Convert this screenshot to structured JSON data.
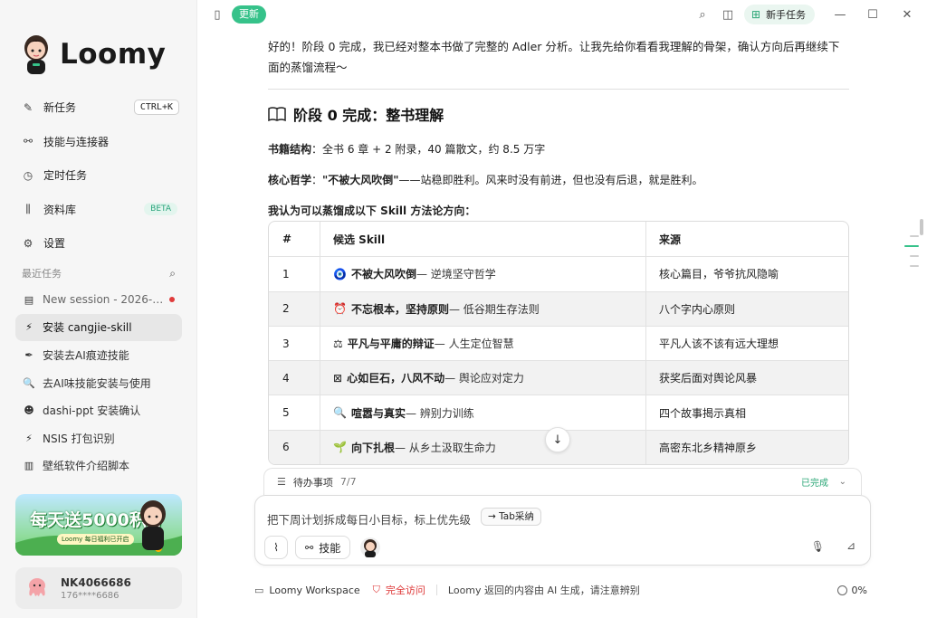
{
  "app": {
    "name": "Loomy"
  },
  "sidebar": {
    "nav": [
      {
        "label": "新任务",
        "icon": "edit-icon",
        "shortcut": "CTRL+K"
      },
      {
        "label": "技能与连接器",
        "icon": "link-icon"
      },
      {
        "label": "定时任务",
        "icon": "clock-icon"
      },
      {
        "label": "资料库",
        "icon": "library-icon",
        "badge": "BETA"
      },
      {
        "label": "设置",
        "icon": "settings-icon"
      }
    ],
    "recent_label": "最近任务",
    "recent": [
      {
        "label": "New session - 2026-…",
        "icon": "notebook-icon",
        "unread": true
      },
      {
        "label": "安装 cangjie-skill",
        "icon": "bolt-icon",
        "active": true
      },
      {
        "label": "安装去AI痕迹技能",
        "icon": "pen-icon"
      },
      {
        "label": "去AI味技能安装与使用",
        "icon": "magnifier-icon"
      },
      {
        "label": "dashi-ppt 安装确认",
        "icon": "robot-icon"
      },
      {
        "label": "NSIS 打包识别",
        "icon": "bolt-icon"
      },
      {
        "label": "壁纸软件介绍脚本",
        "icon": "chart-icon"
      }
    ],
    "promo": {
      "title": "每天送5000积分",
      "subtitle": "Loomy 每日福利已开启"
    },
    "user": {
      "name": "NK4066686",
      "phone": "176****6686"
    }
  },
  "topbar": {
    "update_label": "更新",
    "newbie_label": "新手任务"
  },
  "content": {
    "intro": "好的！阶段 0 完成，我已经对整本书做了完整的 Adler 分析。让我先给你看看我理解的骨架，确认方向后再继续下面的蒸馏流程～",
    "heading": "阶段 0 完成：整书理解",
    "structure_label": "书籍结构",
    "structure_text": "：全书 6 章 + 2 附录，40 篇散文，约 8.5 万字",
    "philosophy_label": "核心哲学",
    "philosophy_quote": "\"不被大风吹倒\"",
    "philosophy_text": "——站稳即胜利。风来时没有前进，但也没有后退，就是胜利。",
    "list_intro": "我认为可以蒸馏成以下 Skill 方法论方向："
  },
  "table": {
    "headers": [
      "#",
      "候选 Skill",
      "来源"
    ],
    "rows": [
      {
        "n": "1",
        "emoji": "🧿",
        "name": "不被大风吹倒",
        "desc": " — 逆境坚守哲学",
        "source": "核心篇目，爷爷抗风隐喻"
      },
      {
        "n": "2",
        "emoji": "⏰",
        "name": "不忘根本，坚持原则",
        "desc": " — 低谷期生存法则",
        "source": "八个字内心原则"
      },
      {
        "n": "3",
        "emoji": "⚖",
        "name": "平凡与平庸的辩证",
        "desc": " — 人生定位智慧",
        "source": "平凡人该不该有远大理想"
      },
      {
        "n": "4",
        "emoji": "⊠",
        "name": "心如巨石，八风不动",
        "desc": " — 舆论应对定力",
        "source": "获奖后面对舆论风暴"
      },
      {
        "n": "5",
        "emoji": "🔍",
        "name": "喧嚣与真实",
        "desc": " — 辨别力训练",
        "source": "四个故事揭示真相"
      },
      {
        "n": "6",
        "emoji": "🌱",
        "name": "向下扎根",
        "desc": " — 从乡土汲取生命力",
        "source": "高密东北乡精神原乡"
      }
    ]
  },
  "todo": {
    "label": "待办事项",
    "count": "7/7",
    "status": "已完成"
  },
  "composer": {
    "placeholder": "把下周计划拆成每日小目标，标上优先级",
    "tab_hint": "→ Tab采纳",
    "skill_label": "技能"
  },
  "footer": {
    "workspace": "Loomy Workspace",
    "access": "完全访问",
    "note": "Loomy 返回的内容由 AI 生成，请注意辨别",
    "progress": "0%"
  },
  "colors": {
    "accent": "#36c28a",
    "danger": "#e03b3b"
  }
}
